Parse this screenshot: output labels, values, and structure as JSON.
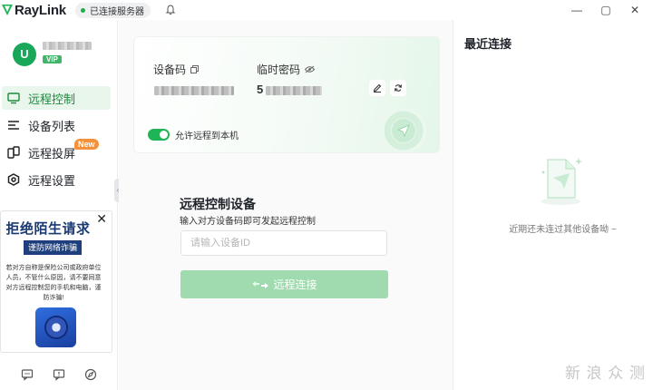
{
  "titlebar": {
    "app_name": "RayLink",
    "status": "已连接服务器",
    "minimize": "—",
    "maximize": "▢",
    "close": "✕"
  },
  "user": {
    "avatar_letter": "U",
    "vip_label": "VIP"
  },
  "nav": {
    "items": [
      {
        "label": "远程控制",
        "active": true
      },
      {
        "label": "设备列表"
      },
      {
        "label": "远程投屏",
        "badge": "New"
      },
      {
        "label": "远程设置"
      }
    ]
  },
  "ad": {
    "close": "✕",
    "title": "拒绝陌生请求",
    "subtitle": "谨防网络诈骗",
    "text": "若对方自称是保险公司或政府单位人员，不管什么原因，请不要同意对方远程控制您的手机和电脑，谨防诈骗!"
  },
  "sidebar_handle": "‹",
  "card": {
    "device_code_label": "设备码",
    "temp_password_label": "临时密码",
    "password_prefix": "5",
    "allow_remote_label": "允许远程到本机",
    "allow_remote_enabled": true
  },
  "remote_control": {
    "title": "远程控制设备",
    "description": "输入对方设备码即可发起远程控制",
    "input_placeholder": "请输入设备ID",
    "input_value": "",
    "connect_label": "远程连接"
  },
  "recent": {
    "title": "最近连接",
    "empty_text": "近期还未连过其他设备呦 ~"
  },
  "watermark": "新 浪 众 测",
  "colors": {
    "brand_green": "#1fb556",
    "active_nav_bg": "#e8f6ec",
    "connect_disabled": "#9fdbae",
    "badge_orange": "#f5913b"
  }
}
